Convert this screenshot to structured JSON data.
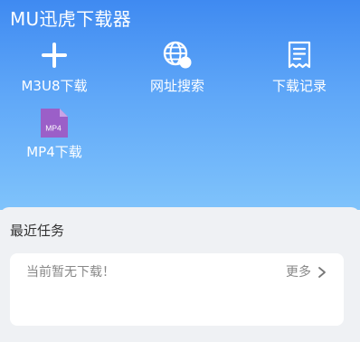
{
  "app": {
    "title": "MU迅虎下载器"
  },
  "tools": {
    "m3u8": {
      "label": "M3U8下载",
      "icon": "plus-icon"
    },
    "web_search": {
      "label": "网址搜索",
      "icon": "globe-search-icon"
    },
    "history": {
      "label": "下载记录",
      "icon": "receipt-list-icon"
    },
    "mp4": {
      "label": "MP4下载",
      "icon": "mp4-file-icon",
      "badge": "MP4"
    }
  },
  "recent": {
    "title": "最近任务",
    "empty_text": "当前暂无下载！",
    "more_label": "更多"
  },
  "colors": {
    "header_gradient_top": "#3f8af1",
    "header_gradient_bottom": "#7fc3fb",
    "mp4_icon": "#9b5fc8",
    "background": "#eff1f4"
  }
}
